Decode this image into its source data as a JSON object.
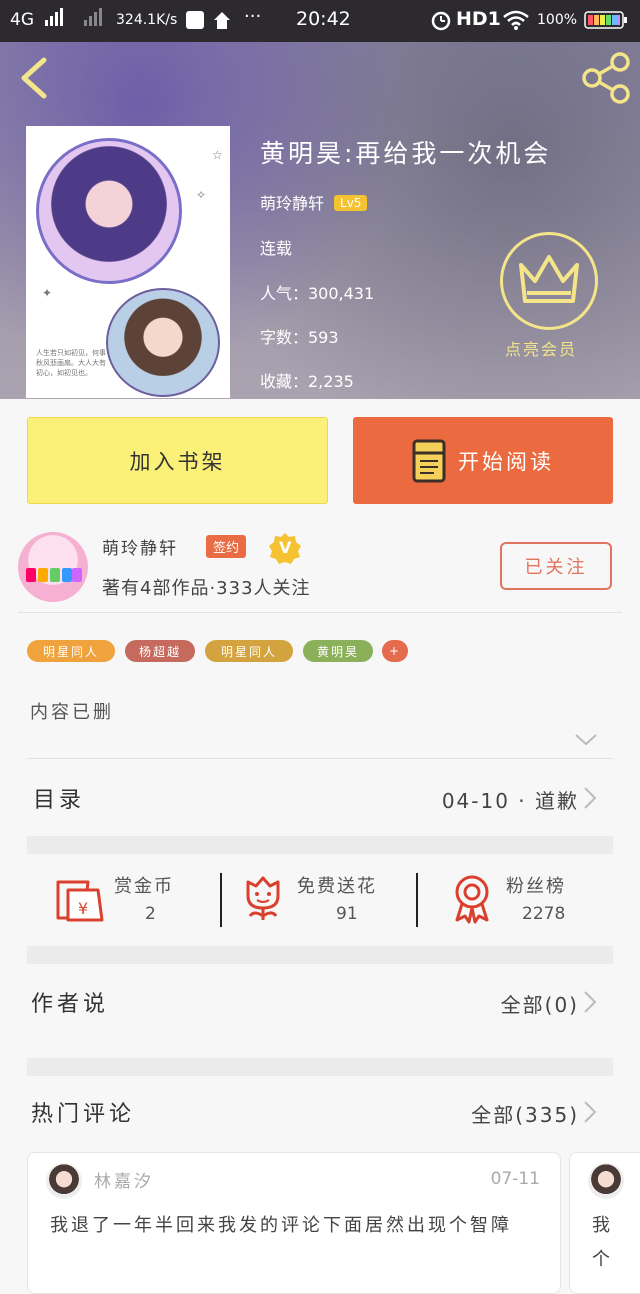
{
  "status_bar": {
    "network": "4G",
    "speed": "324.1K/s",
    "time": "20:42",
    "hd": "HD1",
    "battery": "100%"
  },
  "header": {
    "back_icon": "chevron-left-icon",
    "share_icon": "share-icon"
  },
  "book": {
    "title": "黄明昊:再给我一次机会",
    "author": "萌玲静轩",
    "level": "Lv5",
    "status": "连载",
    "popularity": "人气：300,431",
    "word_count": "字数：593",
    "favorites": "收藏：2,235",
    "cover_note": "人生若只如初见，何事秋风悲画扇。大人大有初心，如初见也。",
    "member_label": "点亮会员"
  },
  "actions": {
    "add_shelf": "加入书架",
    "start_read": "开始阅读"
  },
  "author": {
    "name": "萌玲静轩",
    "sign_badge": "签约",
    "v_badge": "V",
    "meta": "著有4部作品·333人关注",
    "follow_label": "已关注"
  },
  "tags": [
    "明星同人",
    "杨超越",
    "明星同人",
    "黄明昊",
    "+"
  ],
  "tag_colors": [
    "#f0a33c",
    "#c56a5c",
    "#d3a33f",
    "#8bb05a",
    "#e46b4d"
  ],
  "description": "内容已删",
  "catalog": {
    "label": "目录",
    "latest": "04-10 · 道歉"
  },
  "stats": [
    {
      "label": "赏金币",
      "value": "2",
      "icon": "red-envelope-icon"
    },
    {
      "label": "免费送花",
      "value": "91",
      "icon": "flower-icon"
    },
    {
      "label": "粉丝榜",
      "value": "2278",
      "icon": "ribbon-medal-icon"
    }
  ],
  "author_says": {
    "label": "作者说",
    "link": "全部(0)"
  },
  "hot_comments": {
    "label": "热门评论",
    "link": "全部(335)",
    "items": [
      {
        "user": "林嘉汐",
        "date": "07-11",
        "text": "我退了一年半回来我发的评论下面居然出现个智障"
      },
      {
        "user": "",
        "date": "",
        "text": "我个"
      }
    ]
  },
  "colors": {
    "accent_orange": "#ec6a3f",
    "shelf_yellow": "#fbf178",
    "crown_yellow": "#f4e58a"
  }
}
